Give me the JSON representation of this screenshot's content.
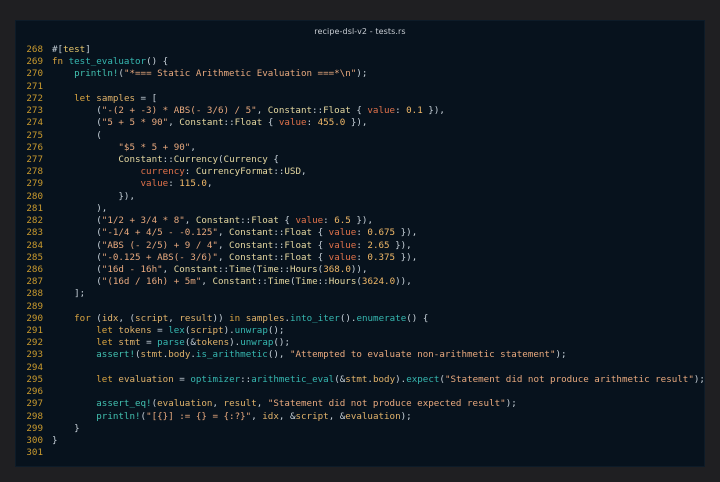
{
  "window": {
    "title": "recipe-dsl-v2 - tests.rs"
  },
  "editor": {
    "lines": [
      {
        "n": "268",
        "t": [
          [
            "punc",
            "#["
          ],
          [
            "attr",
            "test"
          ],
          [
            "punc",
            "]"
          ]
        ]
      },
      {
        "n": "269",
        "t": [
          [
            "kw",
            "fn "
          ],
          [
            "fn",
            "test_evaluator"
          ],
          [
            "punc",
            "() {"
          ]
        ]
      },
      {
        "n": "270",
        "t": [
          [
            "punc",
            "    "
          ],
          [
            "mac",
            "println!"
          ],
          [
            "punc",
            "("
          ],
          [
            "str",
            "\"*=== Static Arithmetic Evaluation ===*\\n\""
          ],
          [
            "punc",
            ");"
          ]
        ]
      },
      {
        "n": "271",
        "t": []
      },
      {
        "n": "272",
        "t": [
          [
            "punc",
            "    "
          ],
          [
            "kw",
            "let "
          ],
          [
            "var",
            "samples"
          ],
          [
            "punc",
            " = ["
          ]
        ]
      },
      {
        "n": "273",
        "t": [
          [
            "punc",
            "        ("
          ],
          [
            "str",
            "\"-(2 + -3) * ABS(- 3/6) / 5\""
          ],
          [
            "punc",
            ", "
          ],
          [
            "ty",
            "Constant"
          ],
          [
            "punc",
            "::"
          ],
          [
            "ty",
            "Float"
          ],
          [
            "punc",
            " { "
          ],
          [
            "field",
            "value"
          ],
          [
            "punc",
            ": "
          ],
          [
            "num",
            "0.1"
          ],
          [
            "punc",
            " }),"
          ]
        ]
      },
      {
        "n": "274",
        "t": [
          [
            "punc",
            "        ("
          ],
          [
            "str",
            "\"5 + 5 * 90\""
          ],
          [
            "punc",
            ", "
          ],
          [
            "ty",
            "Constant"
          ],
          [
            "punc",
            "::"
          ],
          [
            "ty",
            "Float"
          ],
          [
            "punc",
            " { "
          ],
          [
            "field",
            "value"
          ],
          [
            "punc",
            ": "
          ],
          [
            "num",
            "455.0"
          ],
          [
            "punc",
            " }),"
          ]
        ]
      },
      {
        "n": "275",
        "t": [
          [
            "punc",
            "        ("
          ]
        ]
      },
      {
        "n": "276",
        "t": [
          [
            "punc",
            "            "
          ],
          [
            "str",
            "\"$5 * 5 + 90\""
          ],
          [
            "punc",
            ","
          ]
        ]
      },
      {
        "n": "277",
        "t": [
          [
            "punc",
            "            "
          ],
          [
            "ty",
            "Constant"
          ],
          [
            "punc",
            "::"
          ],
          [
            "ty",
            "Currency"
          ],
          [
            "punc",
            "("
          ],
          [
            "ty",
            "Currency"
          ],
          [
            "punc",
            " {"
          ]
        ]
      },
      {
        "n": "278",
        "t": [
          [
            "punc",
            "                "
          ],
          [
            "field",
            "currency"
          ],
          [
            "punc",
            ": "
          ],
          [
            "ty",
            "CurrencyFormat"
          ],
          [
            "punc",
            "::"
          ],
          [
            "ty",
            "USD"
          ],
          [
            "punc",
            ","
          ]
        ]
      },
      {
        "n": "279",
        "t": [
          [
            "punc",
            "                "
          ],
          [
            "field",
            "value"
          ],
          [
            "punc",
            ": "
          ],
          [
            "num",
            "115.0"
          ],
          [
            "punc",
            ","
          ]
        ]
      },
      {
        "n": "280",
        "t": [
          [
            "punc",
            "            }),"
          ]
        ]
      },
      {
        "n": "281",
        "t": [
          [
            "punc",
            "        ),"
          ]
        ]
      },
      {
        "n": "282",
        "t": [
          [
            "punc",
            "        ("
          ],
          [
            "str",
            "\"1/2 + 3/4 * 8\""
          ],
          [
            "punc",
            ", "
          ],
          [
            "ty",
            "Constant"
          ],
          [
            "punc",
            "::"
          ],
          [
            "ty",
            "Float"
          ],
          [
            "punc",
            " { "
          ],
          [
            "field",
            "value"
          ],
          [
            "punc",
            ": "
          ],
          [
            "num",
            "6.5"
          ],
          [
            "punc",
            " }),"
          ]
        ]
      },
      {
        "n": "283",
        "t": [
          [
            "punc",
            "        ("
          ],
          [
            "str",
            "\"-1/4 + 4/5 - -0.125\""
          ],
          [
            "punc",
            ", "
          ],
          [
            "ty",
            "Constant"
          ],
          [
            "punc",
            "::"
          ],
          [
            "ty",
            "Float"
          ],
          [
            "punc",
            " { "
          ],
          [
            "field",
            "value"
          ],
          [
            "punc",
            ": "
          ],
          [
            "num",
            "0.675"
          ],
          [
            "punc",
            " }),"
          ]
        ]
      },
      {
        "n": "284",
        "t": [
          [
            "punc",
            "        ("
          ],
          [
            "str",
            "\"ABS (- 2/5) + 9 / 4\""
          ],
          [
            "punc",
            ", "
          ],
          [
            "ty",
            "Constant"
          ],
          [
            "punc",
            "::"
          ],
          [
            "ty",
            "Float"
          ],
          [
            "punc",
            " { "
          ],
          [
            "field",
            "value"
          ],
          [
            "punc",
            ": "
          ],
          [
            "num",
            "2.65"
          ],
          [
            "punc",
            " }),"
          ]
        ]
      },
      {
        "n": "285",
        "t": [
          [
            "punc",
            "        ("
          ],
          [
            "str",
            "\"-0.125 + ABS(- 3/6)\""
          ],
          [
            "punc",
            ", "
          ],
          [
            "ty",
            "Constant"
          ],
          [
            "punc",
            "::"
          ],
          [
            "ty",
            "Float"
          ],
          [
            "punc",
            " { "
          ],
          [
            "field",
            "value"
          ],
          [
            "punc",
            ": "
          ],
          [
            "num",
            "0.375"
          ],
          [
            "punc",
            " }),"
          ]
        ]
      },
      {
        "n": "286",
        "t": [
          [
            "punc",
            "        ("
          ],
          [
            "str",
            "\"16d - 16h\""
          ],
          [
            "punc",
            ", "
          ],
          [
            "ty",
            "Constant"
          ],
          [
            "punc",
            "::"
          ],
          [
            "ty",
            "Time"
          ],
          [
            "punc",
            "("
          ],
          [
            "ty",
            "Time"
          ],
          [
            "punc",
            "::"
          ],
          [
            "ty",
            "Hours"
          ],
          [
            "punc",
            "("
          ],
          [
            "num",
            "368.0"
          ],
          [
            "punc",
            ")),"
          ]
        ]
      },
      {
        "n": "287",
        "t": [
          [
            "punc",
            "        ("
          ],
          [
            "str",
            "\"(16d / 16h) + 5m\""
          ],
          [
            "punc",
            ", "
          ],
          [
            "ty",
            "Constant"
          ],
          [
            "punc",
            "::"
          ],
          [
            "ty",
            "Time"
          ],
          [
            "punc",
            "("
          ],
          [
            "ty",
            "Time"
          ],
          [
            "punc",
            "::"
          ],
          [
            "ty",
            "Hours"
          ],
          [
            "punc",
            "("
          ],
          [
            "num",
            "3624.0"
          ],
          [
            "punc",
            ")),"
          ]
        ]
      },
      {
        "n": "288",
        "t": [
          [
            "punc",
            "    ];"
          ]
        ]
      },
      {
        "n": "289",
        "t": []
      },
      {
        "n": "290",
        "t": [
          [
            "punc",
            "    "
          ],
          [
            "kw",
            "for "
          ],
          [
            "punc",
            "("
          ],
          [
            "var",
            "idx"
          ],
          [
            "punc",
            ", ("
          ],
          [
            "var",
            "script"
          ],
          [
            "punc",
            ", "
          ],
          [
            "var",
            "result"
          ],
          [
            "punc",
            ")) "
          ],
          [
            "kw",
            "in "
          ],
          [
            "var",
            "samples"
          ],
          [
            "punc",
            "."
          ],
          [
            "fn",
            "into_iter"
          ],
          [
            "punc",
            "()."
          ],
          [
            "fn",
            "enumerate"
          ],
          [
            "punc",
            "() {"
          ]
        ]
      },
      {
        "n": "291",
        "t": [
          [
            "punc",
            "        "
          ],
          [
            "kw",
            "let "
          ],
          [
            "var",
            "tokens"
          ],
          [
            "punc",
            " = "
          ],
          [
            "fn",
            "lex"
          ],
          [
            "punc",
            "("
          ],
          [
            "var",
            "script"
          ],
          [
            "punc",
            ")."
          ],
          [
            "fn",
            "unwrap"
          ],
          [
            "punc",
            "();"
          ]
        ]
      },
      {
        "n": "292",
        "t": [
          [
            "punc",
            "        "
          ],
          [
            "kw",
            "let "
          ],
          [
            "var",
            "stmt"
          ],
          [
            "punc",
            " = "
          ],
          [
            "fn",
            "parse"
          ],
          [
            "punc",
            "(&"
          ],
          [
            "var",
            "tokens"
          ],
          [
            "punc",
            ")."
          ],
          [
            "fn",
            "unwrap"
          ],
          [
            "punc",
            "();"
          ]
        ]
      },
      {
        "n": "293",
        "t": [
          [
            "punc",
            "        "
          ],
          [
            "mac",
            "assert!"
          ],
          [
            "punc",
            "("
          ],
          [
            "var",
            "stmt"
          ],
          [
            "punc",
            "."
          ],
          [
            "var",
            "body"
          ],
          [
            "punc",
            "."
          ],
          [
            "fn",
            "is_arithmetic"
          ],
          [
            "punc",
            "(), "
          ],
          [
            "str",
            "\"Attempted to evaluate non-arithmetic statement\""
          ],
          [
            "punc",
            ");"
          ]
        ]
      },
      {
        "n": "294",
        "t": []
      },
      {
        "n": "295",
        "t": [
          [
            "punc",
            "        "
          ],
          [
            "kw",
            "let "
          ],
          [
            "var",
            "evaluation"
          ],
          [
            "punc",
            " = "
          ],
          [
            "fn",
            "optimizer"
          ],
          [
            "punc",
            "::"
          ],
          [
            "fn",
            "arithmetic_eval"
          ],
          [
            "punc",
            "(&"
          ],
          [
            "var",
            "stmt"
          ],
          [
            "punc",
            "."
          ],
          [
            "var",
            "body"
          ],
          [
            "punc",
            ")."
          ],
          [
            "fn",
            "expect"
          ],
          [
            "punc",
            "("
          ],
          [
            "str",
            "\"Statement did not produce arithmetic result\""
          ],
          [
            "punc",
            ");"
          ]
        ]
      },
      {
        "n": "296",
        "t": []
      },
      {
        "n": "297",
        "t": [
          [
            "punc",
            "        "
          ],
          [
            "mac",
            "assert_eq!"
          ],
          [
            "punc",
            "("
          ],
          [
            "var",
            "evaluation"
          ],
          [
            "punc",
            ", "
          ],
          [
            "var",
            "result"
          ],
          [
            "punc",
            ", "
          ],
          [
            "str",
            "\"Statement did not produce expected result\""
          ],
          [
            "punc",
            ");"
          ]
        ]
      },
      {
        "n": "298",
        "t": [
          [
            "punc",
            "        "
          ],
          [
            "mac",
            "println!"
          ],
          [
            "punc",
            "("
          ],
          [
            "str",
            "\"[{}] := {} = {:?}\""
          ],
          [
            "punc",
            ", "
          ],
          [
            "var",
            "idx"
          ],
          [
            "punc",
            ", &"
          ],
          [
            "var",
            "script"
          ],
          [
            "punc",
            ", &"
          ],
          [
            "var",
            "evaluation"
          ],
          [
            "punc",
            ");"
          ]
        ]
      },
      {
        "n": "299",
        "t": [
          [
            "punc",
            "    }"
          ]
        ]
      },
      {
        "n": "300",
        "t": [
          [
            "punc",
            "}"
          ]
        ]
      },
      {
        "n": "301",
        "t": []
      }
    ]
  }
}
